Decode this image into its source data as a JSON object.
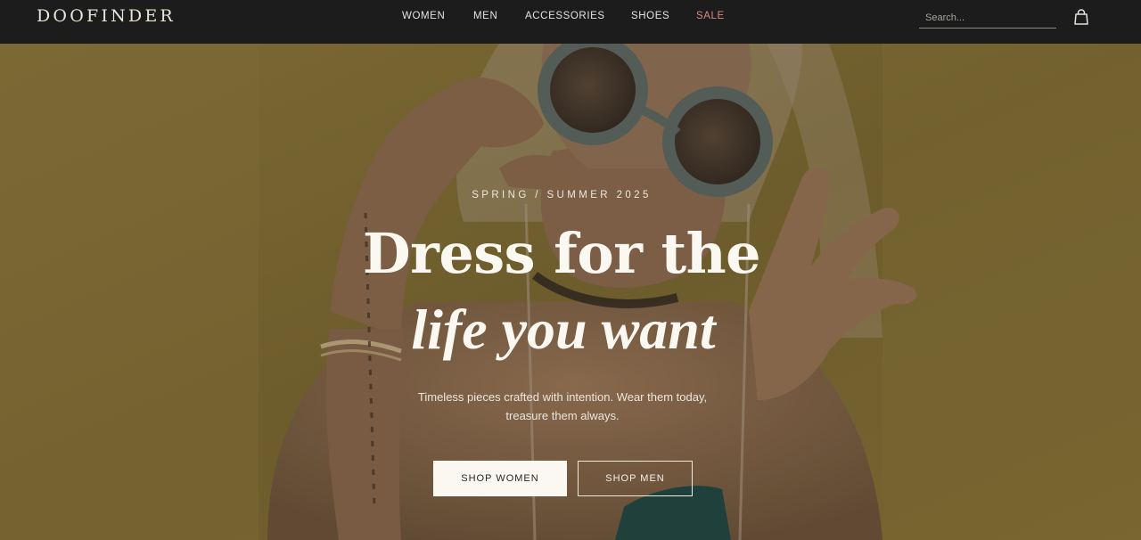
{
  "brand": {
    "logo": "DOOFINDER"
  },
  "nav": {
    "items": [
      {
        "label": "WOMEN"
      },
      {
        "label": "MEN"
      },
      {
        "label": "ACCESSORIES"
      },
      {
        "label": "SHOES"
      },
      {
        "label": "SALE"
      }
    ]
  },
  "search": {
    "placeholder": "Search..."
  },
  "cart": {
    "icon": "shopping-bag-icon"
  },
  "hero": {
    "eyebrow": "SPRING / SUMMER 2025",
    "headline_line1": "Dress for the",
    "headline_line2": "life you want",
    "subtitle_line1": "Timeless pieces crafted with intention. Wear them today,",
    "subtitle_line2": "treasure them always.",
    "primary_button": "SHOP WOMEN",
    "secondary_button": "SHOP MEN"
  },
  "colors": {
    "nav_background": "#1c1c1c",
    "sale_accent": "#d88a7e",
    "hero_background": "#7a6a34"
  }
}
